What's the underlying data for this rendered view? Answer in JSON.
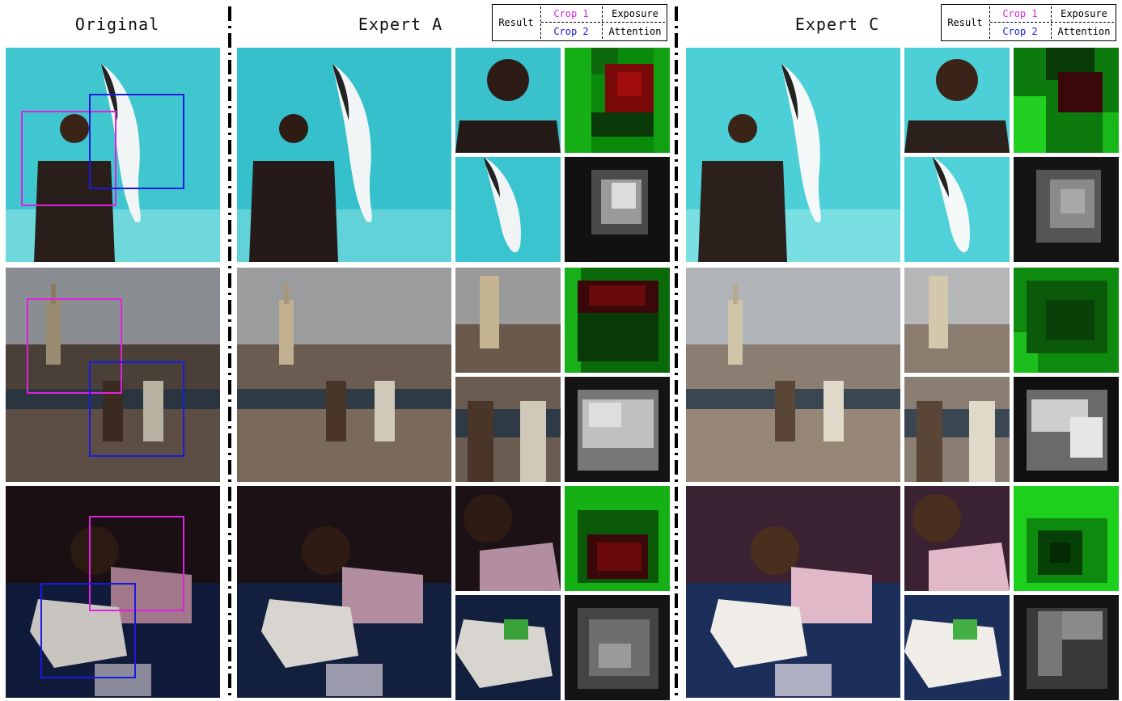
{
  "columns": {
    "original": "Original",
    "expert_a": "Expert A",
    "expert_c": "Expert C"
  },
  "legend": {
    "result": "Result",
    "crop1": "Crop 1",
    "crop2": "Crop 2",
    "exposure": "Exposure",
    "attention": "Attention"
  },
  "colors": {
    "crop1_box": "#e020e0",
    "crop2_box": "#1a1ae0"
  }
}
